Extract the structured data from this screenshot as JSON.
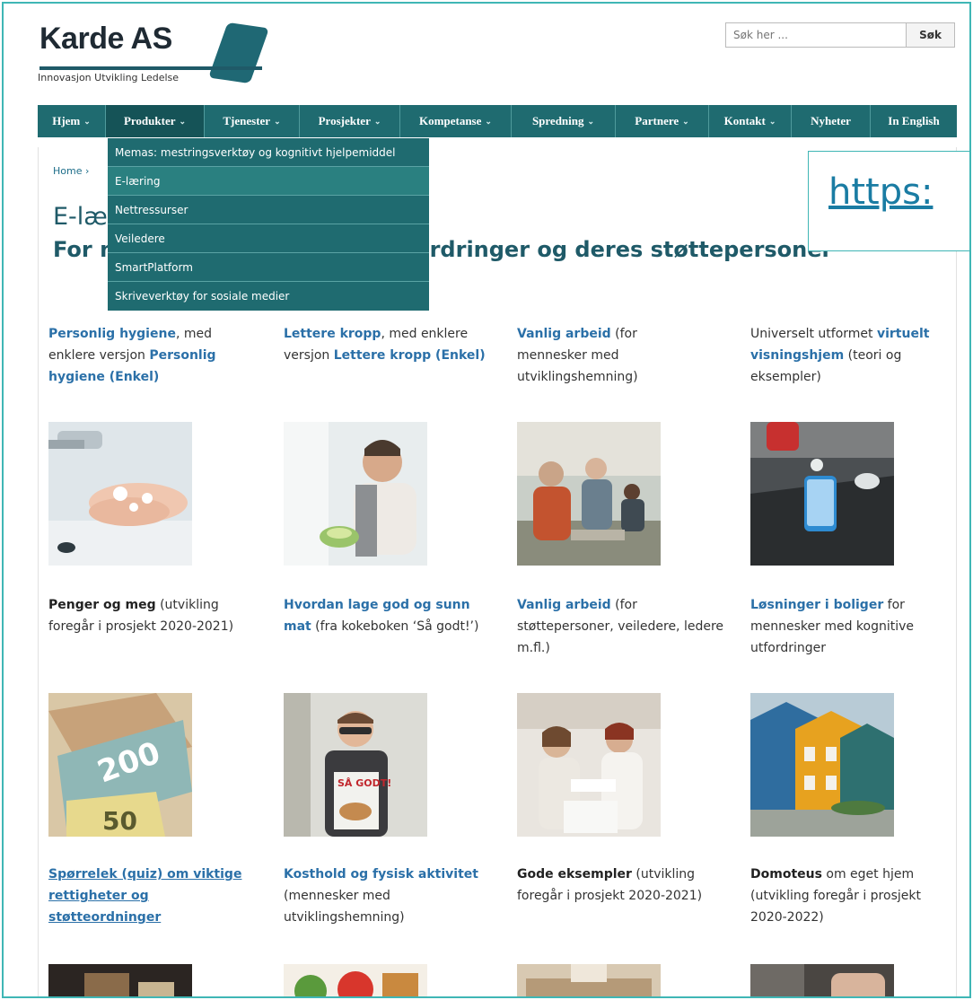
{
  "header": {
    "logo_title": "Karde AS",
    "logo_tagline": "Innovasjon Utvikling Ledelse",
    "search_placeholder": "Søk her ...",
    "search_button": "Søk"
  },
  "nav": {
    "items": [
      {
        "label": "Hjem",
        "chevron": true
      },
      {
        "label": "Produkter",
        "chevron": true
      },
      {
        "label": "Tjenester",
        "chevron": true
      },
      {
        "label": "Prosjekter",
        "chevron": true
      },
      {
        "label": "Kompetanse",
        "chevron": true
      },
      {
        "label": "Spredning",
        "chevron": true
      },
      {
        "label": "Partnere",
        "chevron": true
      },
      {
        "label": "Kontakt",
        "chevron": true
      },
      {
        "label": "Nyheter",
        "chevron": false
      },
      {
        "label": "In English",
        "chevron": false
      }
    ],
    "chevron_glyph": "⌄"
  },
  "dropdown": {
    "items": [
      "Memas: mestringsverktøy og kognitivt hjelpemiddel",
      "E-læring",
      "Nettressurser",
      "Veiledere",
      "SmartPlatform",
      "Skriveverktøy for sosiale medier"
    ]
  },
  "breadcrumb": {
    "home": "Home",
    "sep": "›"
  },
  "page": {
    "title": "E-læ",
    "subtitle_left": "For n",
    "subtitle_right": "tfordringer og deres støttepersoner"
  },
  "url_overlay": "https:",
  "cards": {
    "r1c1": {
      "a": "Personlig hygiene",
      "b": ", med enklere versjon ",
      "c": "Personlig hygiene (Enkel)"
    },
    "r1c2": {
      "a": "Lettere kropp",
      "b": ", med enklere versjon ",
      "c": "Lettere kropp (Enkel)"
    },
    "r1c3": {
      "a": "Vanlig arbeid",
      "b": " (for mennesker med utviklingshemning)"
    },
    "r1c4": {
      "a": "Universelt utformet ",
      "b": "virtuelt visningshjem",
      "c": " (teori og eksempler)"
    },
    "r2c1": {
      "a": "Penger og meg",
      "b": " (utvikling foregår i prosjekt 2020-2021)"
    },
    "r2c2": {
      "a": "Hvordan lage god og sunn mat",
      "b": " (fra kokeboken ‘Så godt!’)"
    },
    "r2c3": {
      "a": "Vanlig arbeid",
      "b": " (for støttepersoner, veiledere, ledere m.fl.)"
    },
    "r2c4": {
      "a": "Løsninger i boliger",
      "b": " for mennesker med kognitive utfordringer"
    },
    "r3c1": {
      "a": "Spørrelek (quiz) om viktige rettigheter og støtteordninger"
    },
    "r3c2": {
      "a": "Kosthold og fysisk aktivitet",
      "b": " (mennesker med utviklingshemning)"
    },
    "r3c3": {
      "a": "Gode eksempler",
      "b": " (utvikling foregår i prosjekt 2020-2021)"
    },
    "r3c4": {
      "a": "Domoteus",
      "b": " om eget hjem (utvikling foregår i prosjekt 2020-2022)"
    }
  },
  "images": {
    "r2c1_banknote_200": "200",
    "r2c1_banknote_50": "50",
    "r2c2_book": "SÅ GODT!"
  },
  "colors": {
    "nav_bg": "#1f6b70",
    "link": "#2b70a8",
    "title": "#1f5a68",
    "frame": "#3fb6b5"
  }
}
